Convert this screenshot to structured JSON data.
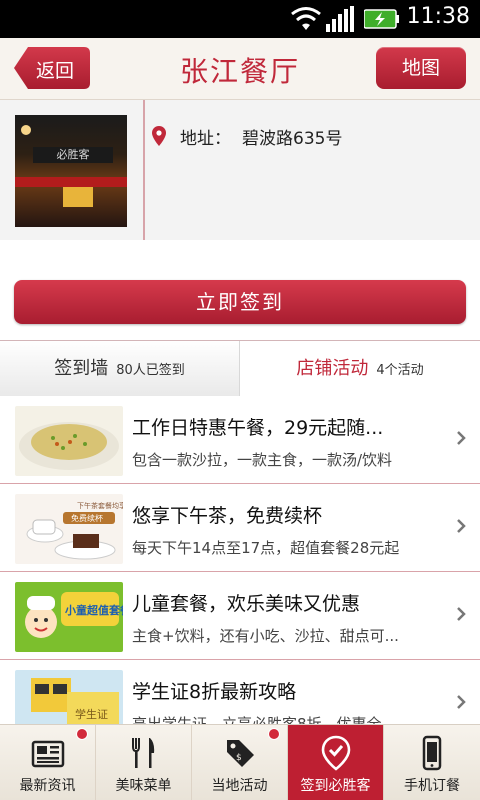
{
  "status_bar": {
    "time": "11:38"
  },
  "header": {
    "back_label": "返回",
    "title": "张江餐厅",
    "map_label": "地图"
  },
  "store": {
    "address_label": "地址：",
    "address_value": "碧波路635号"
  },
  "checkin_button": "立即签到",
  "tabs": [
    {
      "name": "签到墙",
      "count": "80人已签到",
      "selected": false
    },
    {
      "name": "店铺活动",
      "count": "4个活动",
      "selected": true
    }
  ],
  "activities": [
    {
      "title": "工作日特惠午餐，29元起随...",
      "desc": "包含一款沙拉，一款主食，一款汤/饮料"
    },
    {
      "title": "悠享下午茶，免费续杯",
      "desc": "每天下午14点至17点，超值套餐28元起",
      "thumb_text": "下午茶套餐均享有饮料",
      "thumb_badge": "免费续杯"
    },
    {
      "title": "儿童套餐，欢乐美味又优惠",
      "desc": "主食+饮料，还有小吃、沙拉、甜点可...",
      "thumb_text": "小童超值套餐"
    },
    {
      "title": "学生证8折最新攻略",
      "desc": "亮出学生证，立享必胜客8折，优惠全...",
      "thumb_text": "学生证"
    }
  ],
  "bottom_nav": [
    {
      "label": "最新资讯",
      "icon": "newspaper-icon",
      "badge": true,
      "active": false
    },
    {
      "label": "美味菜单",
      "icon": "fork-knife-icon",
      "badge": false,
      "active": false
    },
    {
      "label": "当地活动",
      "icon": "price-tag-icon",
      "badge": true,
      "active": false
    },
    {
      "label": "签到必胜客",
      "icon": "location-check-icon",
      "badge": false,
      "active": true
    },
    {
      "label": "手机订餐",
      "icon": "mobile-phone-icon",
      "badge": false,
      "active": false
    }
  ],
  "colors": {
    "brand_red": "#c0283a",
    "tab_active_bg": "#be1f32",
    "header_bg": "#f7f3ee"
  }
}
